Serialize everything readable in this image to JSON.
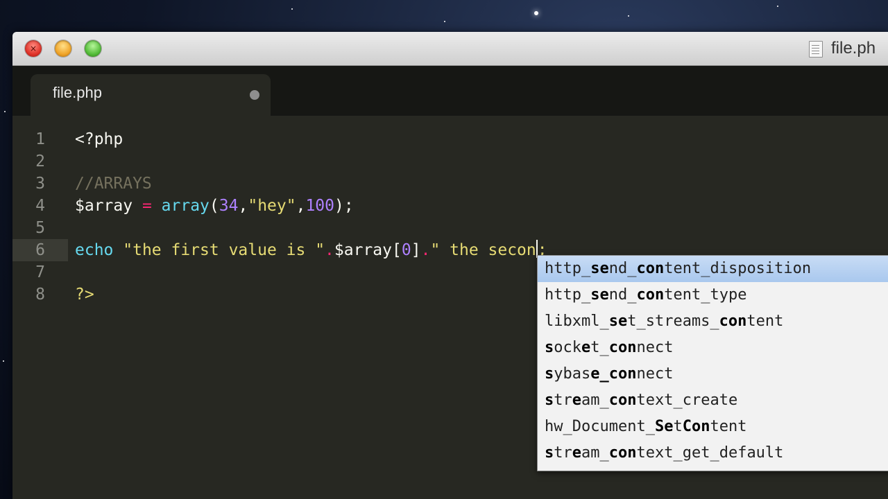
{
  "window": {
    "title": "file.ph",
    "controls": [
      "close",
      "minimize",
      "zoom"
    ]
  },
  "tabs": [
    {
      "label": "file.php",
      "modified": true,
      "active": true
    }
  ],
  "editor": {
    "current_line": 6,
    "lines": [
      {
        "number": "1",
        "tokens": [
          {
            "t": "<?php",
            "c": "tag"
          }
        ]
      },
      {
        "number": "2",
        "tokens": []
      },
      {
        "number": "3",
        "tokens": [
          {
            "t": "//ARRAYS",
            "c": "comment"
          }
        ]
      },
      {
        "number": "4",
        "tokens": [
          {
            "t": "$array",
            "c": "var"
          },
          {
            "t": " ",
            "c": "punc"
          },
          {
            "t": "=",
            "c": "op"
          },
          {
            "t": " ",
            "c": "punc"
          },
          {
            "t": "array",
            "c": "func"
          },
          {
            "t": "(",
            "c": "punc"
          },
          {
            "t": "34",
            "c": "num"
          },
          {
            "t": ",",
            "c": "punc"
          },
          {
            "t": "\"hey\"",
            "c": "str"
          },
          {
            "t": ",",
            "c": "punc"
          },
          {
            "t": "100",
            "c": "num"
          },
          {
            "t": ");",
            "c": "punc"
          }
        ]
      },
      {
        "number": "5",
        "tokens": []
      },
      {
        "number": "6",
        "tokens": [
          {
            "t": "echo",
            "c": "func"
          },
          {
            "t": " ",
            "c": "punc"
          },
          {
            "t": "\"the first value is \"",
            "c": "str"
          },
          {
            "t": ".",
            "c": "op"
          },
          {
            "t": "$array",
            "c": "var"
          },
          {
            "t": "[",
            "c": "punc"
          },
          {
            "t": "0",
            "c": "num"
          },
          {
            "t": "]",
            "c": "punc"
          },
          {
            "t": ".",
            "c": "op"
          },
          {
            "t": "\" the secon",
            "c": "str"
          },
          {
            "t": "|",
            "c": "cursor"
          },
          {
            "t": ";",
            "c": "str"
          }
        ]
      },
      {
        "number": "7",
        "tokens": []
      },
      {
        "number": "8",
        "tokens": [
          {
            "t": "?>",
            "c": "str"
          }
        ]
      }
    ]
  },
  "autocomplete": {
    "selected_index": 0,
    "items": [
      {
        "label": "http_send_content_disposition",
        "bold": [
          [
            5,
            7
          ],
          [
            10,
            13
          ]
        ]
      },
      {
        "label": "http_send_content_type",
        "bold": [
          [
            5,
            7
          ],
          [
            10,
            13
          ]
        ]
      },
      {
        "label": "libxml_set_streams_content",
        "bold": [
          [
            7,
            9
          ],
          [
            19,
            22
          ]
        ]
      },
      {
        "label": "socket_connect",
        "bold": [
          [
            0,
            1
          ],
          [
            4,
            5
          ],
          [
            7,
            10
          ]
        ]
      },
      {
        "label": "sybase_connect",
        "bold": [
          [
            0,
            1
          ],
          [
            5,
            7
          ],
          [
            7,
            10
          ]
        ]
      },
      {
        "label": "stream_context_create",
        "bold": [
          [
            0,
            1
          ],
          [
            3,
            4
          ],
          [
            7,
            10
          ]
        ]
      },
      {
        "label": "hw_Document_SetContent",
        "bold": [
          [
            12,
            14
          ],
          [
            15,
            18
          ]
        ]
      },
      {
        "label": "stream_context_get_default",
        "bold": [
          [
            0,
            1
          ],
          [
            3,
            4
          ],
          [
            7,
            10
          ]
        ]
      }
    ]
  },
  "colors": {
    "editor_bg": "#272822",
    "tab_bar_bg": "#161714",
    "keyword": "#66d9ef",
    "operator": "#f92672",
    "number": "#ae81ff",
    "string": "#e6db74",
    "comment": "#75715e",
    "popup_selection": "#a9c8ee"
  }
}
